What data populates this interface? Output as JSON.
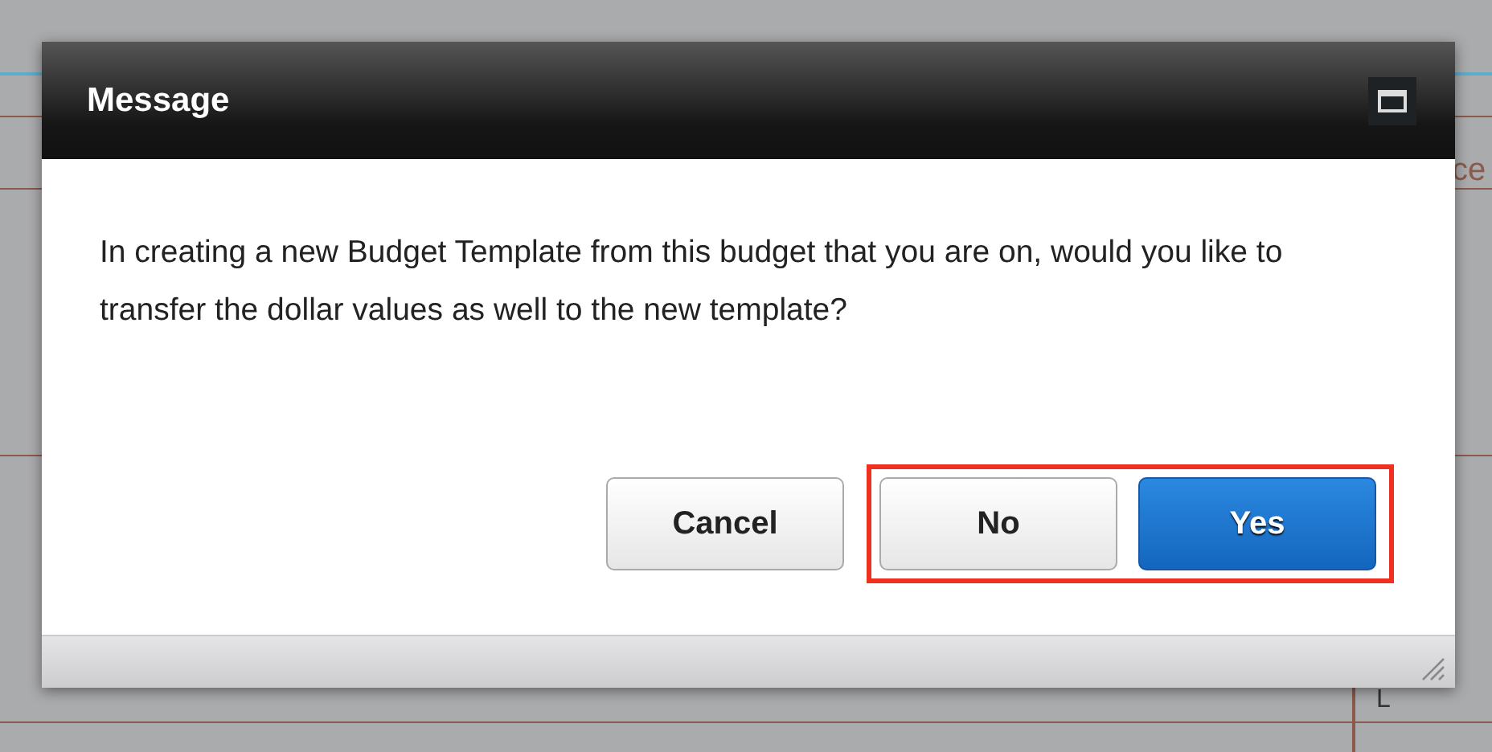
{
  "background": {
    "texts": [
      "ce",
      "L"
    ]
  },
  "dialog": {
    "title": "Message",
    "message": "In creating a new Budget Template from this budget that you are on, would you like to transfer the dollar values as well to the new template?",
    "buttons": [
      {
        "label": "Cancel",
        "kind": "plain",
        "highlighted": false
      },
      {
        "label": "No",
        "kind": "plain",
        "highlighted": true
      },
      {
        "label": "Yes",
        "kind": "primary",
        "highlighted": true
      }
    ]
  }
}
